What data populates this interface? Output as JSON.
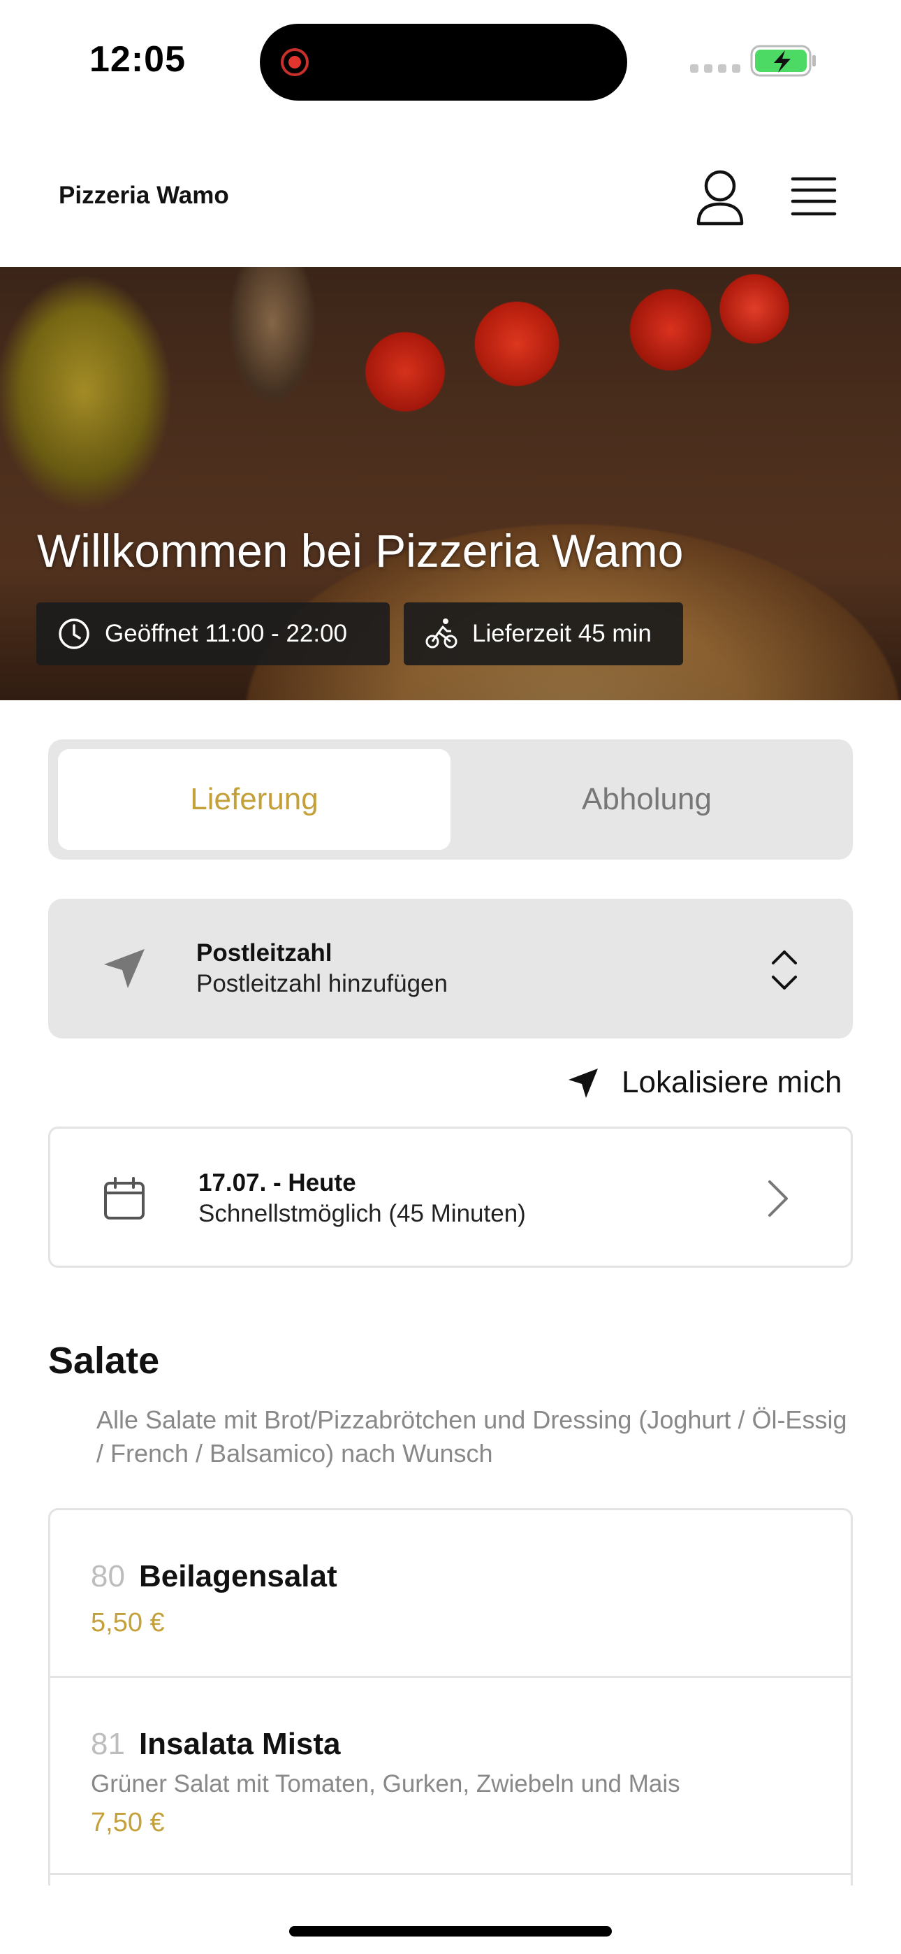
{
  "status_bar": {
    "time": "12:05"
  },
  "header": {
    "brand": "Pizzeria Wamo"
  },
  "hero": {
    "title": "Willkommen bei Pizzeria Wamo",
    "opening": "Geöffnet 11:00 - 22:00",
    "delivery_time": "Lieferzeit 45 min"
  },
  "mode": {
    "tabs": [
      "Lieferung",
      "Abholung"
    ],
    "selected": "Lieferung"
  },
  "postcode": {
    "label": "Postleitzahl",
    "value": "Postleitzahl hinzufügen"
  },
  "locate": {
    "label": "Lokalisiere mich"
  },
  "date": {
    "title": "17.07. - Heute",
    "subtitle": "Schnellstmöglich (45 Minuten)"
  },
  "section": {
    "title": "Salate",
    "description": "Alle Salate mit Brot/Pizzabrötchen und Dressing (Joghurt / Öl-Essig / French / Balsamico) nach Wunsch"
  },
  "items": [
    {
      "number": "80",
      "name": "Beilagensalat",
      "description": "",
      "price": "5,50 €"
    },
    {
      "number": "81",
      "name": "Insalata Mista",
      "description": "Grüner Salat mit Tomaten, Gurken, Zwiebeln und Mais",
      "price": "7,50 €"
    }
  ],
  "colors": {
    "accent": "#c4a03a",
    "panel": "#e6e6e6",
    "muted": "#888888"
  },
  "icons": {
    "status": [
      "record-icon",
      "signal-icon",
      "battery-charging-icon"
    ],
    "header": [
      "user-icon",
      "hamburger-menu-icon"
    ],
    "hero": [
      "clock-icon",
      "bicycle-icon"
    ],
    "postcode": [
      "location-arrow-icon",
      "chevron-up-down-icon"
    ],
    "locate": "location-arrow-icon",
    "date": [
      "calendar-icon",
      "chevron-right-icon"
    ]
  }
}
